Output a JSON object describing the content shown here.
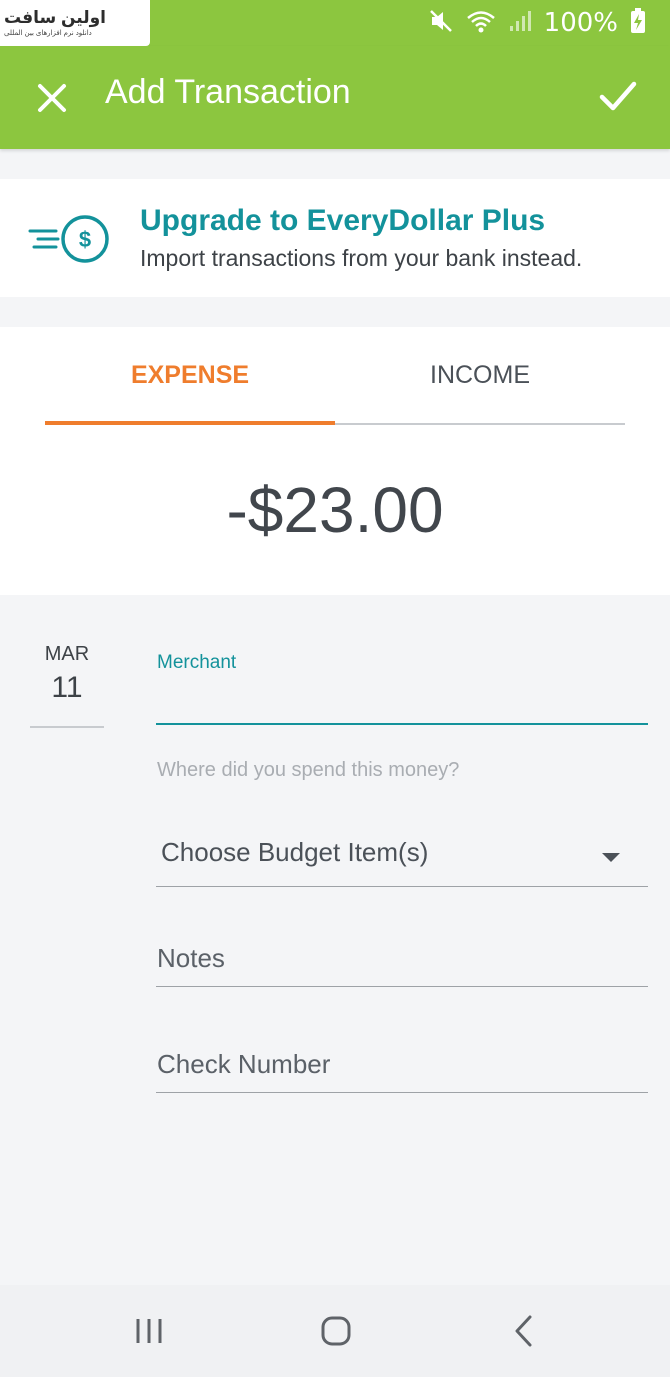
{
  "status_bar": {
    "watermark_title": "اولین سافت",
    "watermark_subtitle": "دانلود نرم افزارهای بین المللی",
    "battery_percent": "100%",
    "accent_color": "#8cc63f"
  },
  "app_bar": {
    "title": "Add Transaction",
    "close_icon": "close-icon",
    "confirm_icon": "check-icon"
  },
  "upgrade_banner": {
    "title": "Upgrade to EveryDollar Plus",
    "subtitle": "Import transactions from your bank instead.",
    "icon": "dollar-coin-icon"
  },
  "transaction_type": {
    "tabs": [
      {
        "label": "EXPENSE",
        "selected": true
      },
      {
        "label": "INCOME",
        "selected": false
      }
    ],
    "amount": "-$23.00"
  },
  "form": {
    "date": {
      "month": "MAR",
      "day": "11"
    },
    "merchant": {
      "label": "Merchant",
      "value": "",
      "helper": "Where did you spend this money?"
    },
    "budget_item": {
      "label": "Choose Budget Item(s)"
    },
    "notes": {
      "placeholder": "Notes",
      "value": ""
    },
    "check_number": {
      "placeholder": "Check Number",
      "value": ""
    }
  },
  "colors": {
    "teal": "#13929b",
    "orange": "#ef7d2d",
    "green": "#8cc63f"
  }
}
